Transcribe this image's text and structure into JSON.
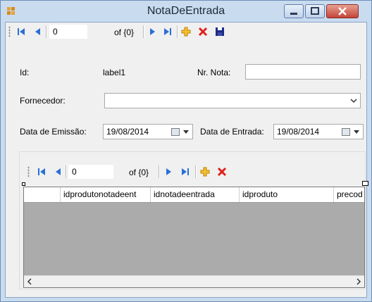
{
  "window": {
    "title": "NotaDeEntrada"
  },
  "binding_navigator": {
    "position": "0",
    "count_label": "of {0}"
  },
  "form": {
    "id_label": "Id:",
    "id_value": "label1",
    "nr_nota_label": "Nr. Nota:",
    "nr_nota_value": "",
    "fornecedor_label": "Fornecedor:",
    "fornecedor_value": "",
    "data_emissao_label": "Data de Emissão:",
    "data_emissao_value": "19/08/2014",
    "data_entrada_label": "Data de Entrada:",
    "data_entrada_value": "19/08/2014"
  },
  "items_navigator": {
    "position": "0",
    "count_label": "of {0}"
  },
  "grid": {
    "columns": [
      "idprodutonotadeent",
      "idnotadeentrada",
      "idproduto",
      "precod"
    ]
  },
  "colors": {
    "add": "#e8a800",
    "delete": "#e0201b",
    "nav": "#2a6fd6",
    "save": "#1a2a8a"
  }
}
